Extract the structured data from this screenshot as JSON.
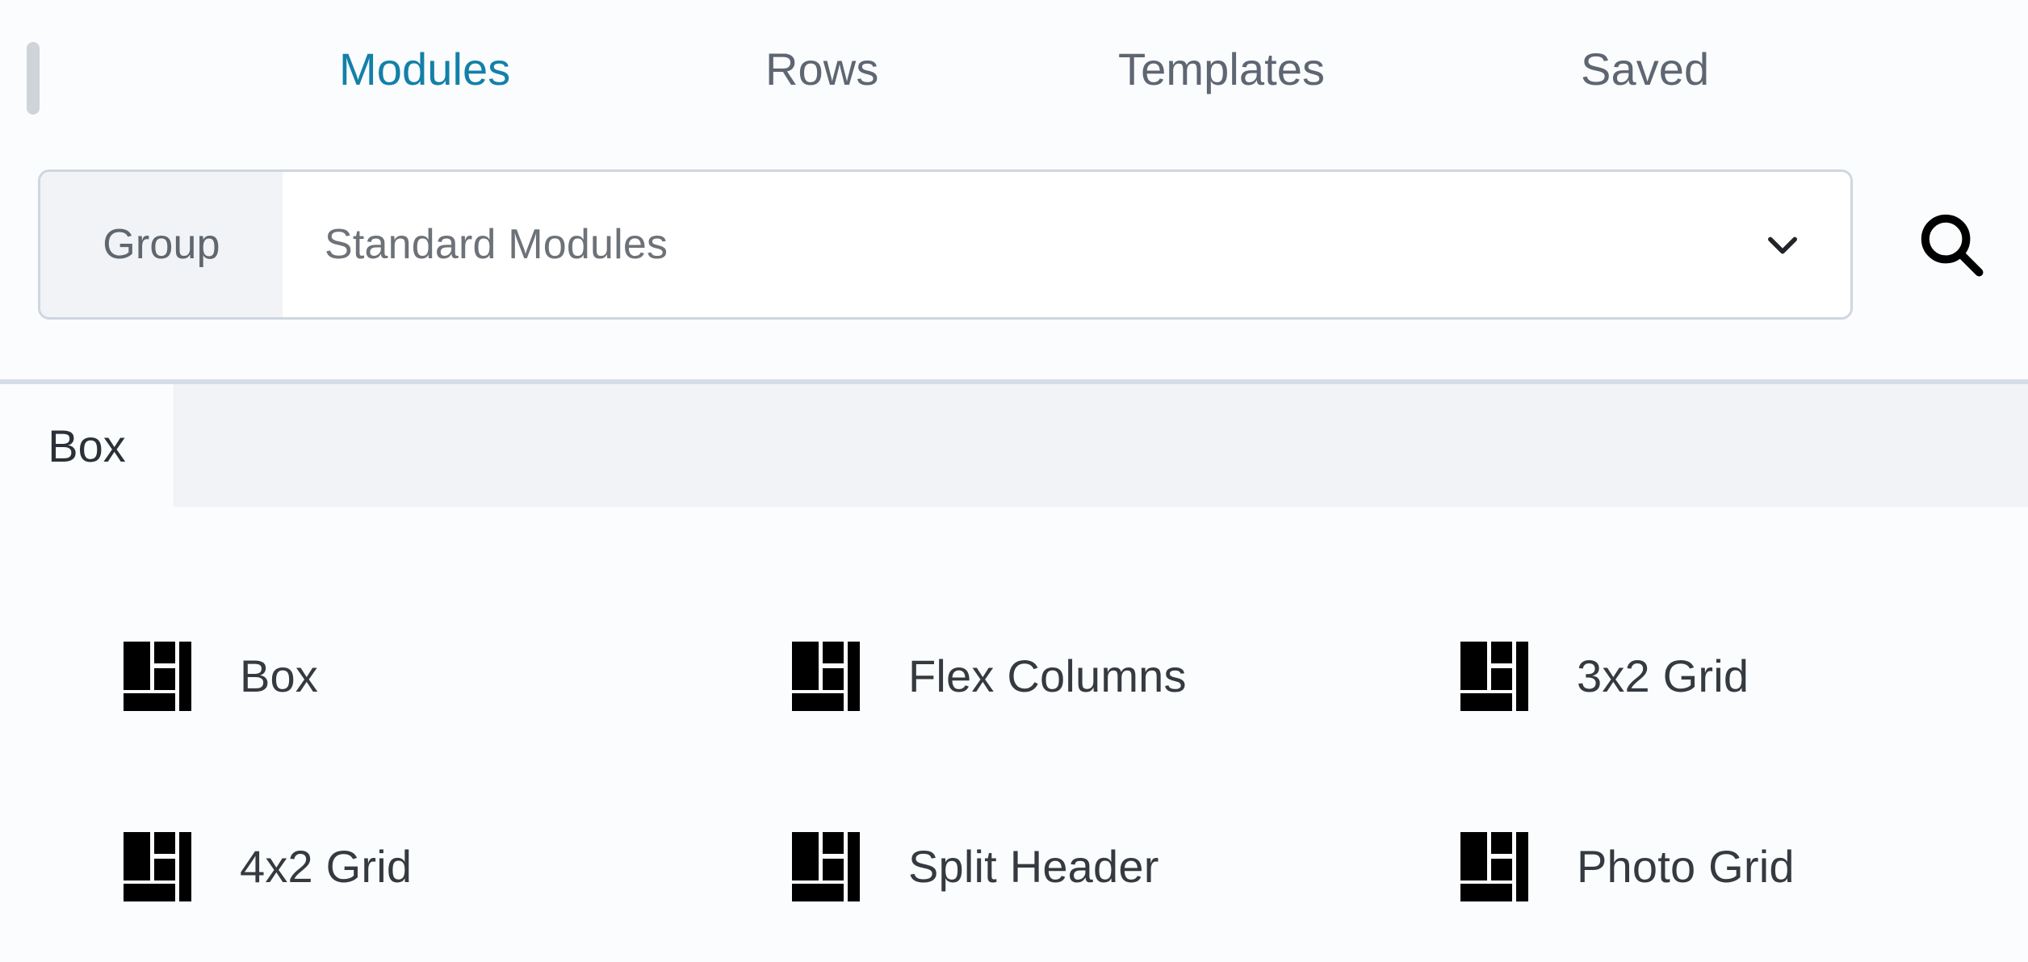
{
  "window": {
    "background": "#fbfcfd"
  },
  "colors": {
    "accent": "#1380a8",
    "tab_inactive": "#5e6672",
    "label_text": "#343a40",
    "muted_text": "#6d7278",
    "border": "#ced6e0",
    "strip_bg": "#f1f3f7",
    "handle": "#ced4da"
  },
  "tabs": {
    "active": "Modules",
    "items": [
      {
        "label": "Modules",
        "active": true
      },
      {
        "label": "Rows",
        "active": false
      },
      {
        "label": "Templates",
        "active": false
      },
      {
        "label": "Saved",
        "active": false
      }
    ]
  },
  "search": {
    "prefix_label": "Group",
    "selected_group": "Standard Modules",
    "dropdown_icon": "chevron-down-icon",
    "search_icon": "search-icon"
  },
  "group_tabs": {
    "items": [
      {
        "label": "Box",
        "active": true
      }
    ]
  },
  "modules": {
    "items": [
      {
        "label": "Box",
        "icon": "layout-grid-icon"
      },
      {
        "label": "Flex Columns",
        "icon": "layout-grid-icon"
      },
      {
        "label": "3x2 Grid",
        "icon": "layout-grid-icon"
      },
      {
        "label": "4x2 Grid",
        "icon": "layout-grid-icon"
      },
      {
        "label": "Split Header",
        "icon": "layout-grid-icon"
      },
      {
        "label": "Photo Grid",
        "icon": "layout-grid-icon"
      }
    ]
  }
}
